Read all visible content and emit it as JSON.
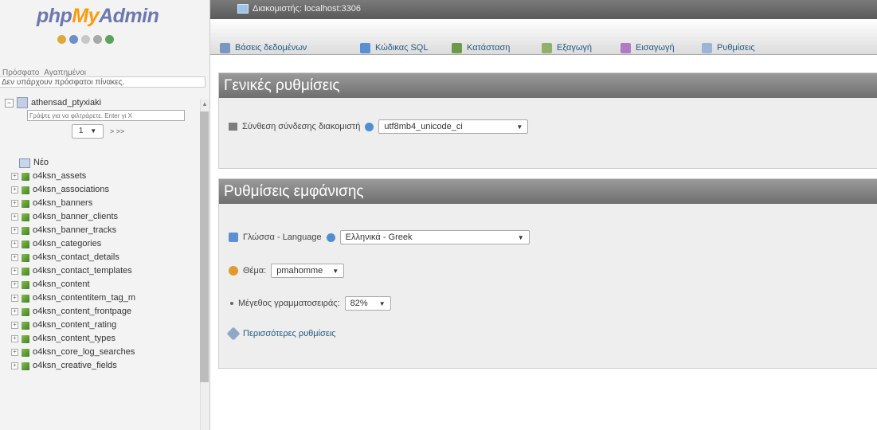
{
  "logo": {
    "php": "php",
    "my": "My",
    "admin": "Admin"
  },
  "sidebar": {
    "tabs": [
      "Πρόσφατο",
      "Αγαπημένοι"
    ],
    "no_recent": "Δεν υπάρχουν πρόσφατοι πίνακες.",
    "database": "athensad_ptyxiaki",
    "filter_placeholder": "Γράψτε για να φιλτράρετε. Enter γι Χ",
    "page": "1",
    "next": "> >>",
    "new_label": "Νέο",
    "tables": [
      "o4ksn_assets",
      "o4ksn_associations",
      "o4ksn_banners",
      "o4ksn_banner_clients",
      "o4ksn_banner_tracks",
      "o4ksn_categories",
      "o4ksn_contact_details",
      "o4ksn_contact_templates",
      "o4ksn_content",
      "o4ksn_contentitem_tag_m",
      "o4ksn_content_frontpage",
      "o4ksn_content_rating",
      "o4ksn_content_types",
      "o4ksn_core_log_searches",
      "o4ksn_creative_fields"
    ]
  },
  "topbar": {
    "server": "Διακομιστής: localhost:3306"
  },
  "tabs": [
    {
      "label": "Βάσεις δεδομένων",
      "icon": "database-icon",
      "color": "#7a97c4"
    },
    {
      "label": "Κώδικας SQL",
      "icon": "sql-icon",
      "color": "#5b8fd3"
    },
    {
      "label": "Κατάσταση",
      "icon": "status-icon",
      "color": "#6d9a48"
    },
    {
      "label": "Εξαγωγή",
      "icon": "export-icon",
      "color": "#8fb16a"
    },
    {
      "label": "Εισαγωγή",
      "icon": "import-icon",
      "color": "#b07ac4"
    },
    {
      "label": "Ρυθμίσεις",
      "icon": "settings-icon",
      "color": "#9ab5d6"
    }
  ],
  "general": {
    "title": "Γενικές ρυθμίσεις",
    "collation_label": "Σύνθεση σύνδεσης διακομιστή",
    "collation_value": "utf8mb4_unicode_ci"
  },
  "display": {
    "title": "Ρυθμίσεις εμφάνισης",
    "language_label": "Γλώσσα - Language",
    "language_value": "Ελληνικά - Greek",
    "theme_label": "Θέμα:",
    "theme_value": "pmahomme",
    "fontsize_label": "Μέγεθος γραμματοσειράς:",
    "fontsize_value": "82%",
    "more_settings": "Περισσότερες ρυθμίσεις"
  }
}
